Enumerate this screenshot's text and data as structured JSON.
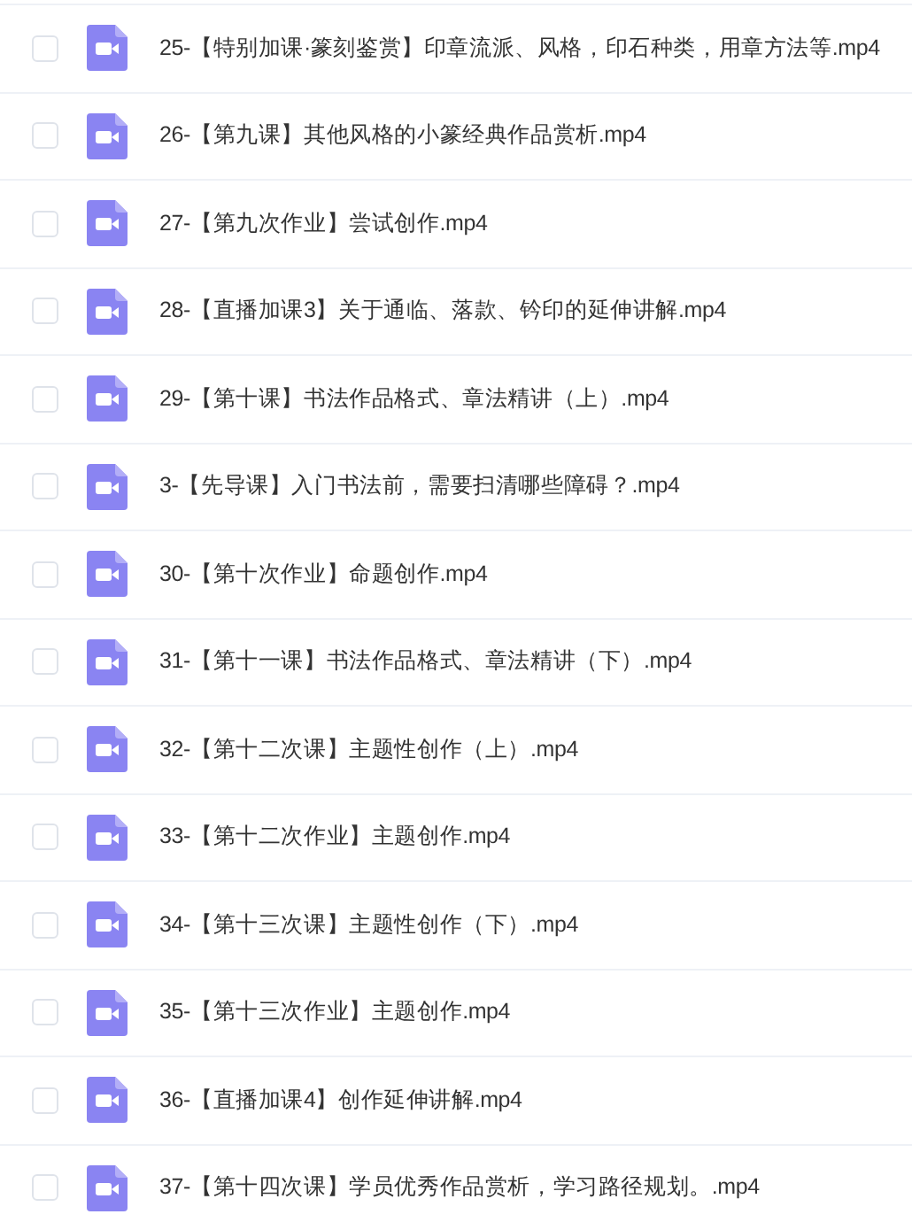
{
  "files": [
    {
      "name": "25-【特别加课·篆刻鉴赏】印章流派、风格，印石种类，用章方法等.mp4",
      "checked": false
    },
    {
      "name": "26-【第九课】其他风格的小篆经典作品赏析.mp4",
      "checked": false
    },
    {
      "name": "27-【第九次作业】尝试创作.mp4",
      "checked": false
    },
    {
      "name": "28-【直播加课3】关于通临、落款、钤印的延伸讲解.mp4",
      "checked": false
    },
    {
      "name": "29-【第十课】书法作品格式、章法精讲（上）.mp4",
      "checked": false
    },
    {
      "name": "3-【先导课】入门书法前，需要扫清哪些障碍？.mp4",
      "checked": false
    },
    {
      "name": "30-【第十次作业】命题创作.mp4",
      "checked": false
    },
    {
      "name": "31-【第十一课】书法作品格式、章法精讲（下）.mp4",
      "checked": false
    },
    {
      "name": "32-【第十二次课】主题性创作（上）.mp4",
      "checked": false
    },
    {
      "name": "33-【第十二次作业】主题创作.mp4",
      "checked": false
    },
    {
      "name": "34-【第十三次课】主题性创作（下）.mp4",
      "checked": false
    },
    {
      "name": "35-【第十三次作业】主题创作.mp4",
      "checked": false
    },
    {
      "name": "36-【直播加课4】创作延伸讲解.mp4",
      "checked": false
    },
    {
      "name": "37-【第十四次课】学员优秀作品赏析，学习路径规划。.mp4",
      "checked": false
    }
  ]
}
